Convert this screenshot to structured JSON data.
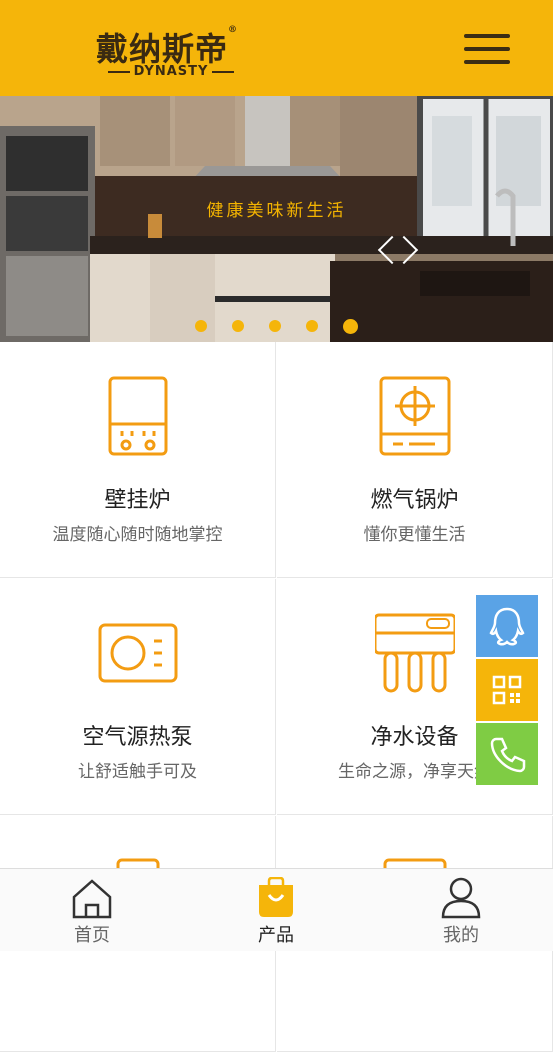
{
  "header": {
    "logo_cn": "戴纳斯帝",
    "logo_reg": "®",
    "logo_en": "DYNASTY",
    "menu_icon": "hamburger-menu-icon",
    "bg_color": "#f5b50a"
  },
  "banner": {
    "slogan": "健康美味新生活",
    "slide_count": 5,
    "active_slide": 5,
    "arrow_icon": "chevron-icon"
  },
  "products": [
    {
      "title": "壁挂炉",
      "desc": "温度随心随时随地掌控",
      "icon": "wall-boiler-icon"
    },
    {
      "title": "燃气锅炉",
      "desc": "懂你更懂生活",
      "icon": "gas-boiler-icon"
    },
    {
      "title": "空气源热泵",
      "desc": "让舒适触手可及",
      "icon": "heat-pump-icon"
    },
    {
      "title": "净水设备",
      "desc": "生命之源，净享天然",
      "icon": "water-purifier-icon"
    },
    {
      "title": "",
      "desc": "",
      "icon": "product-icon"
    },
    {
      "title": "",
      "desc": "",
      "icon": "product-icon"
    }
  ],
  "float_buttons": [
    {
      "icon": "qq-icon",
      "color": "#5aa3e6"
    },
    {
      "icon": "qr-code-icon",
      "color": "#f5b50a"
    },
    {
      "icon": "phone-icon",
      "color": "#7fcc44"
    }
  ],
  "bottom_nav": [
    {
      "label": "首页",
      "icon": "home-icon"
    },
    {
      "label": "产品",
      "icon": "shopping-bag-icon",
      "active": true
    },
    {
      "label": "我的",
      "icon": "user-icon"
    }
  ],
  "colors": {
    "accent": "#f5b50a",
    "icon_orange": "#f39c12"
  }
}
